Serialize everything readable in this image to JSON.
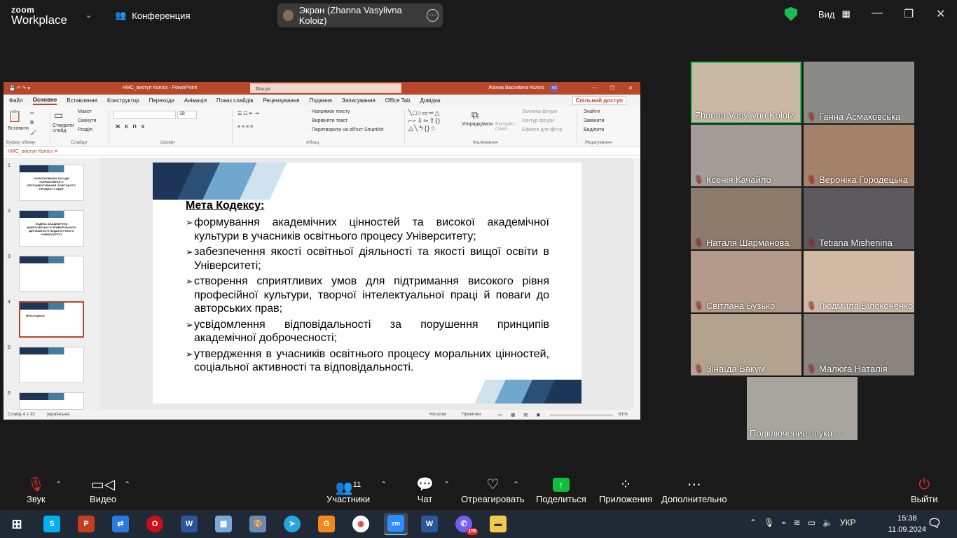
{
  "zoom": {
    "logo_top": "zoom",
    "logo_bottom": "Workplace",
    "conference_label": "Конференция",
    "screen_share_label": "Экран (Zhanna Vasylivna Koloiz)",
    "view_label": "Вид"
  },
  "ppt": {
    "title": "НМС_виступ Колоіз - PowerPoint",
    "search_placeholder": "Пошук",
    "user": "Жанна Василівна Колоіз",
    "user_initials": "ЖК",
    "menu": [
      "Файл",
      "Основне",
      "Вставлення",
      "Конструктор",
      "Переходи",
      "Анімація",
      "Показ слайдів",
      "Рецензування",
      "Подання",
      "Записування",
      "Office Tab",
      "Довідка"
    ],
    "share_button": "Спільний доступ",
    "ribbon": {
      "paste": "Вставити",
      "clipboard_group": "Буфер обміну",
      "new_slide": "Створити слайд",
      "layout": "Макет",
      "reset": "Скинути",
      "section": "Розділ",
      "slides_group": "Слайди",
      "font_group": "Шрифт",
      "paragraph_group": "Абзац",
      "text_direction": "Напрямок тексту",
      "align_text": "Вирівняти текст",
      "smartart": "Перетворити на об'єкт SmartArt",
      "drawing_group": "Малювання",
      "arrange": "Упорядкувати",
      "quick_styles": "Експрес-стилі",
      "shape_fill": "Заливка фігури",
      "shape_outline": "Контур фігури",
      "shape_effects": "Ефекти для фігур",
      "find": "Знайти",
      "replace": "Замінити",
      "select": "Виділити",
      "editing_group": "Редагування",
      "font_size": "18"
    },
    "doc_tab": "НМС_виступ Колоіз",
    "thumbnails": [
      {
        "num": "1",
        "text": "НАЙОСНОВНІШІ ЗАСАДИ НОРМАТИВНОГО РЕГЛАМЕНТУВАННЯ ОСВІТНЬОГО ПРОЦЕСУ У КДПУ"
      },
      {
        "num": "2",
        "text": "КОДЕКС АКАДЕМІЧНОЇ ДОБРОЧЕСНОСТІ КРИВОРІЗЬКОГО ДЕРЖАВНОГО ПЕДАГОГІЧНОГО УНІВЕРСИТЕТУ"
      },
      {
        "num": "3",
        "text": ""
      },
      {
        "num": "4",
        "text": "Мета Кодексу"
      },
      {
        "num": "5",
        "text": ""
      },
      {
        "num": "6",
        "text": ""
      }
    ],
    "slide": {
      "title": "Мета Кодексу:",
      "bullets": [
        "формування академічних цінностей та високої академічної культури в учасників освітнього процесу Університету;",
        "забезпечення якості освітньої діяльності та якості вищої освіти в Університеті;",
        "створення сприятливих умов для підтримання високого рівня професійної культури, творчої інтелектуальної праці й поваги до авторських прав;",
        "усвідомлення відповідальності за порушення принципів академічної доброчесності;",
        "утвердження в учасників освітнього процесу моральних цінностей, соціальної активності та відповідальності."
      ]
    },
    "status": {
      "slide_of": "Слайд 4 з 33",
      "language": "українська",
      "notes": "Нотатки",
      "comments": "Примітки",
      "zoom": "81%"
    }
  },
  "participants": [
    {
      "name": "Zhanna Vasylivna Koloiz",
      "muted": false,
      "active": true
    },
    {
      "name": "Ганна Асмаковська",
      "muted": true,
      "active": false
    },
    {
      "name": "Ксенія Качайло",
      "muted": true,
      "active": false
    },
    {
      "name": "Вероніка Городецька",
      "muted": true,
      "active": false
    },
    {
      "name": "Наталя Шарманова",
      "muted": true,
      "active": false
    },
    {
      "name": "Tetiana Mishenina",
      "muted": true,
      "active": false
    },
    {
      "name": "Світлана Бузько",
      "muted": true,
      "active": false
    },
    {
      "name": "Людмила Білоконенко",
      "muted": true,
      "active": false
    },
    {
      "name": "Зінаїда Бакум",
      "muted": true,
      "active": false
    },
    {
      "name": "Малюга Наталія",
      "muted": true,
      "active": false
    },
    {
      "name": "Подключение звука ···",
      "muted": false,
      "active": false
    }
  ],
  "toolbar": {
    "audio": "Звук",
    "video": "Видео",
    "participants": "Участники",
    "participants_count": "11",
    "chat": "Чат",
    "react": "Отреагировать",
    "share": "Поделиться",
    "apps": "Приложения",
    "more": "Дополнительно",
    "leave": "Выйти"
  },
  "taskbar": {
    "lang": "УКР",
    "time": "15:38",
    "date": "11.09.2024",
    "viber_badge": "155"
  },
  "colors": {
    "ppt_accent": "#b7472a",
    "zoom_bg": "#1a1a1a",
    "active_speaker": "#20c35a",
    "share_green": "#0fbf3c",
    "muted_red": "#e02828"
  }
}
